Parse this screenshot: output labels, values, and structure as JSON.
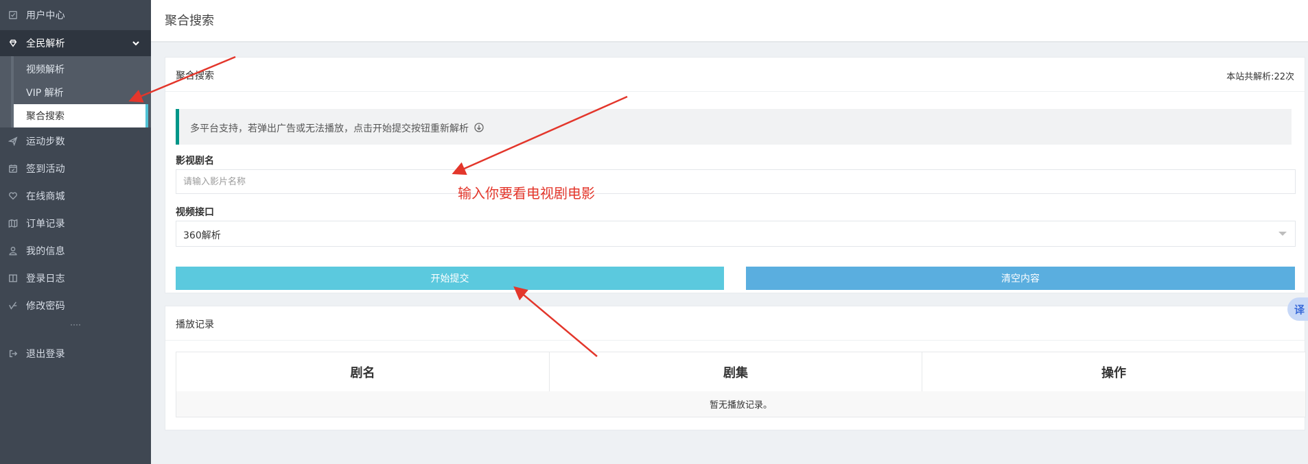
{
  "sidebar": {
    "items": [
      {
        "label": "用户中心",
        "icon": "check-square-icon"
      },
      {
        "label": "全民解析",
        "icon": "diamond-icon"
      },
      {
        "label": "运动步数",
        "icon": "send-icon"
      },
      {
        "label": "签到活动",
        "icon": "calendar-icon"
      },
      {
        "label": "在线商城",
        "icon": "heart-icon"
      },
      {
        "label": "订单记录",
        "icon": "map-icon"
      },
      {
        "label": "我的信息",
        "icon": "user-icon"
      },
      {
        "label": "登录日志",
        "icon": "book-icon"
      },
      {
        "label": "修改密码",
        "icon": "key-check-icon"
      },
      {
        "label": "退出登录",
        "icon": "logout-icon"
      }
    ],
    "sub_items": [
      {
        "label": "视频解析"
      },
      {
        "label": "VIP 解析"
      },
      {
        "label": "聚合搜索"
      }
    ]
  },
  "header": {
    "title": "聚合搜索"
  },
  "search_panel": {
    "title": "聚合搜索",
    "stats": "本站共解析:22次",
    "notice": "多平台支持，若弹出广告或无法播放，点击开始提交按钮重新解析",
    "name_label": "影视剧名",
    "name_placeholder": "请输入影片名称",
    "name_value": "",
    "interface_label": "视频接口",
    "interface_value": "360解析",
    "submit_label": "开始提交",
    "clear_label": "清空内容"
  },
  "history_panel": {
    "title": "播放记录",
    "columns": [
      "剧名",
      "剧集",
      "操作"
    ],
    "empty_text": "暂无播放记录。"
  },
  "annotation": {
    "text": "输入你要看电视剧电影"
  },
  "translate_tab": {
    "label": "译"
  },
  "colors": {
    "sidebar_bg": "#3f4752",
    "accent_teal": "#009688",
    "submit_btn": "#5bc9de",
    "clear_btn": "#5aaedf",
    "annotation_red": "#e3362b"
  }
}
